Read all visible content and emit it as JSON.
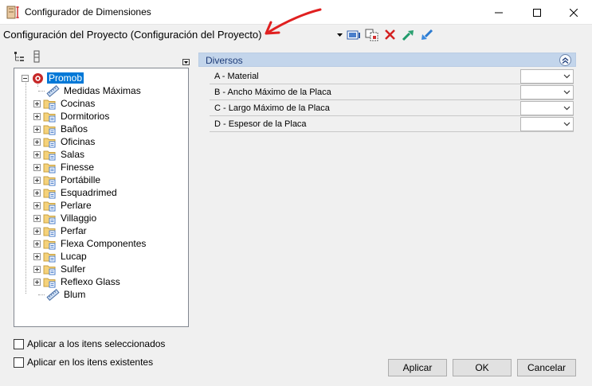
{
  "window": {
    "title": "Configurador de Dimensiones"
  },
  "toolbar": {
    "config_value": "Configuración del Proyecto (Configuración del Proyecto)",
    "icons": [
      "screen-icon",
      "copy-icon",
      "delete-icon",
      "export-icon",
      "import-icon"
    ]
  },
  "tree": {
    "root": "Promob",
    "items": [
      {
        "label": "Medidas Máximas",
        "expandable": false,
        "icon": "ruler-icon"
      },
      {
        "label": "Cocinas",
        "expandable": true,
        "icon": "folder-icon"
      },
      {
        "label": "Dormitorios",
        "expandable": true,
        "icon": "folder-icon"
      },
      {
        "label": "Baños",
        "expandable": true,
        "icon": "folder-icon"
      },
      {
        "label": "Oficinas",
        "expandable": true,
        "icon": "folder-icon"
      },
      {
        "label": "Salas",
        "expandable": true,
        "icon": "folder-icon"
      },
      {
        "label": "Finesse",
        "expandable": true,
        "icon": "folder-icon"
      },
      {
        "label": "Portábille",
        "expandable": true,
        "icon": "folder-icon"
      },
      {
        "label": "Esquadrimed",
        "expandable": true,
        "icon": "folder-icon"
      },
      {
        "label": "Perlare",
        "expandable": true,
        "icon": "folder-icon"
      },
      {
        "label": "Villaggio",
        "expandable": true,
        "icon": "folder-icon"
      },
      {
        "label": "Perfar",
        "expandable": true,
        "icon": "folder-icon"
      },
      {
        "label": "Flexa Componentes",
        "expandable": true,
        "icon": "folder-icon"
      },
      {
        "label": "Lucap",
        "expandable": true,
        "icon": "folder-icon"
      },
      {
        "label": "Sulfer",
        "expandable": true,
        "icon": "folder-icon"
      },
      {
        "label": "Reflexo Glass",
        "expandable": true,
        "icon": "folder-icon"
      },
      {
        "label": "Blum",
        "expandable": false,
        "icon": "ruler-icon"
      }
    ]
  },
  "grid": {
    "group_title": "Diversos",
    "properties": [
      {
        "label": "A - Material",
        "value": ""
      },
      {
        "label": "B -  Ancho Máximo de la Placa",
        "value": ""
      },
      {
        "label": "C - Largo Máximo de la Placa",
        "value": ""
      },
      {
        "label": "D - Espesor de la Placa",
        "value": ""
      }
    ]
  },
  "options": {
    "apply_selected": "Aplicar a los itens seleccionados",
    "apply_existing": "Aplicar en los itens existentes"
  },
  "buttons": {
    "apply": "Aplicar",
    "ok": "OK",
    "cancel": "Cancelar"
  },
  "colors": {
    "selection": "#0078d7",
    "group_header": "#c3d5eb",
    "annotation_arrow": "#e02020"
  }
}
